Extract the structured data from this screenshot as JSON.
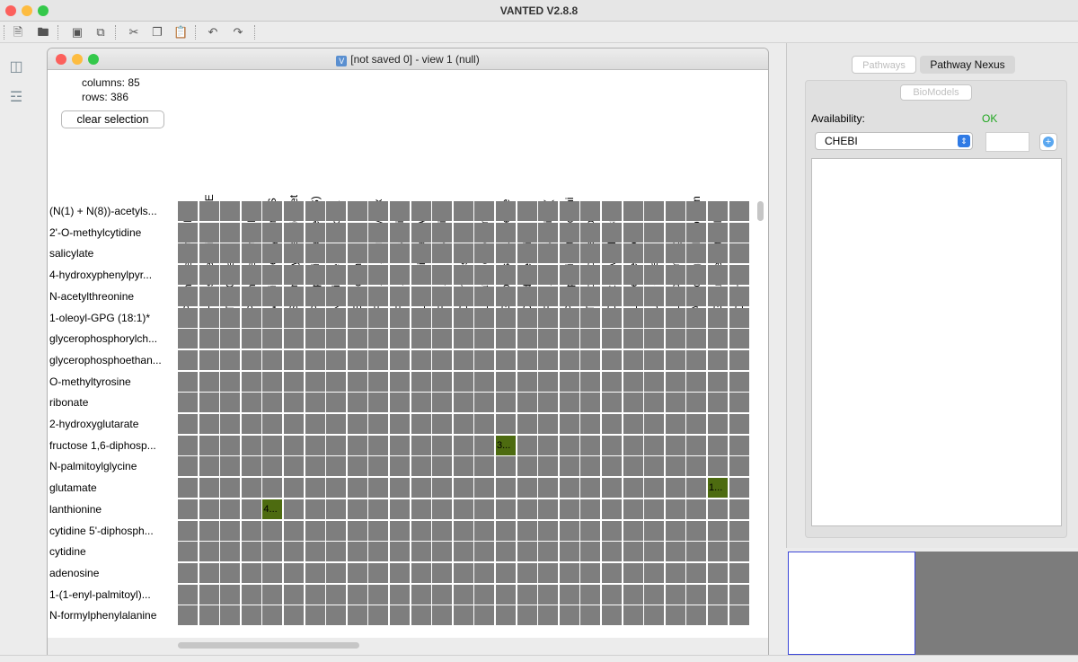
{
  "app": {
    "title": "VANTED V2.8.8"
  },
  "colors": {
    "close": "#fc605c",
    "minimize": "#fdbc40",
    "maximize": "#34c84a",
    "cell": "#7e7e7e",
    "highlight": "#4d6b10",
    "ok": "#1fa71f"
  },
  "toolbar": {
    "icons": [
      "new-file-icon",
      "open-icon",
      "save-icon",
      "save-all-icon",
      "cut-icon",
      "copy-icon",
      "paste-icon",
      "undo-icon",
      "redo-icon"
    ]
  },
  "view": {
    "title": "[not saved 0] - view 1 (null)",
    "columns_text": "columns: 85",
    "rows_text": "rows: 386",
    "clear_label": "clear selection",
    "columns": [
      "Pyrimidine Metabolism,",
      "Hexosylceramides (HCE",
      "TCA Cycle",
      "Pyrimidine Metabolism,",
      "Methionine, Cysteine, S",
      "Secondary Bile Acid Met",
      "Phosphatidylserine (PS)",
      "Nicotinate and Nicotina",
      "Endocannabinoid",
      "Fatty Acid, Monohydrox",
      "Fatty Acid Metabolism(",
      "Long Chain Fatty Acid",
      "Fatty Acid Metabolism",
      "Ceramides",
      "Lipoate Metabolism",
      "Glycolysis, Gluconeoge",
      "Dihydroceramides",
      "Fatty Acid Metabolism (",
      "Phosphatidylethanolami",
      "Tocopherol Metabolism",
      "Creatine Metabolism",
      "Lysine Metabolism",
      "Urea cycle",
      "Lysoplasmalogen",
      "Aminosugar Metabolism",
      "Glutamate Metabolism",
      "Chemical"
    ],
    "rows": [
      "(N(1) + N(8))-acetyls...",
      "2'-O-methylcytidine",
      "salicylate",
      "4-hydroxyphenylpyr...",
      "N-acetylthreonine",
      "1-oleoyl-GPG (18:1)*",
      "glycerophosphorylch...",
      "glycerophosphoethan...",
      "O-methyltyrosine",
      "ribonate",
      "2-hydroxyglutarate",
      "fructose 1,6-diphosp...",
      "N-palmitoylglycine",
      "glutamate",
      "lanthionine",
      "cytidine 5'-diphosph...",
      "cytidine",
      "adenosine",
      "1-(1-enyl-palmitoyl)...",
      "N-formylphenylalanine"
    ],
    "highlights": [
      {
        "row": 11,
        "col": 15,
        "text": "3..."
      },
      {
        "row": 13,
        "col": 25,
        "text": "1..."
      },
      {
        "row": 14,
        "col": 4,
        "text": "4..."
      }
    ]
  },
  "right_panel": {
    "tab_pathways": "Pathways",
    "tab_nexus": "Pathway Nexus",
    "subtab_biomodels": "BioModels",
    "availability_label": "Availability:",
    "availability_status": "OK",
    "database_selected": "CHEBI"
  }
}
